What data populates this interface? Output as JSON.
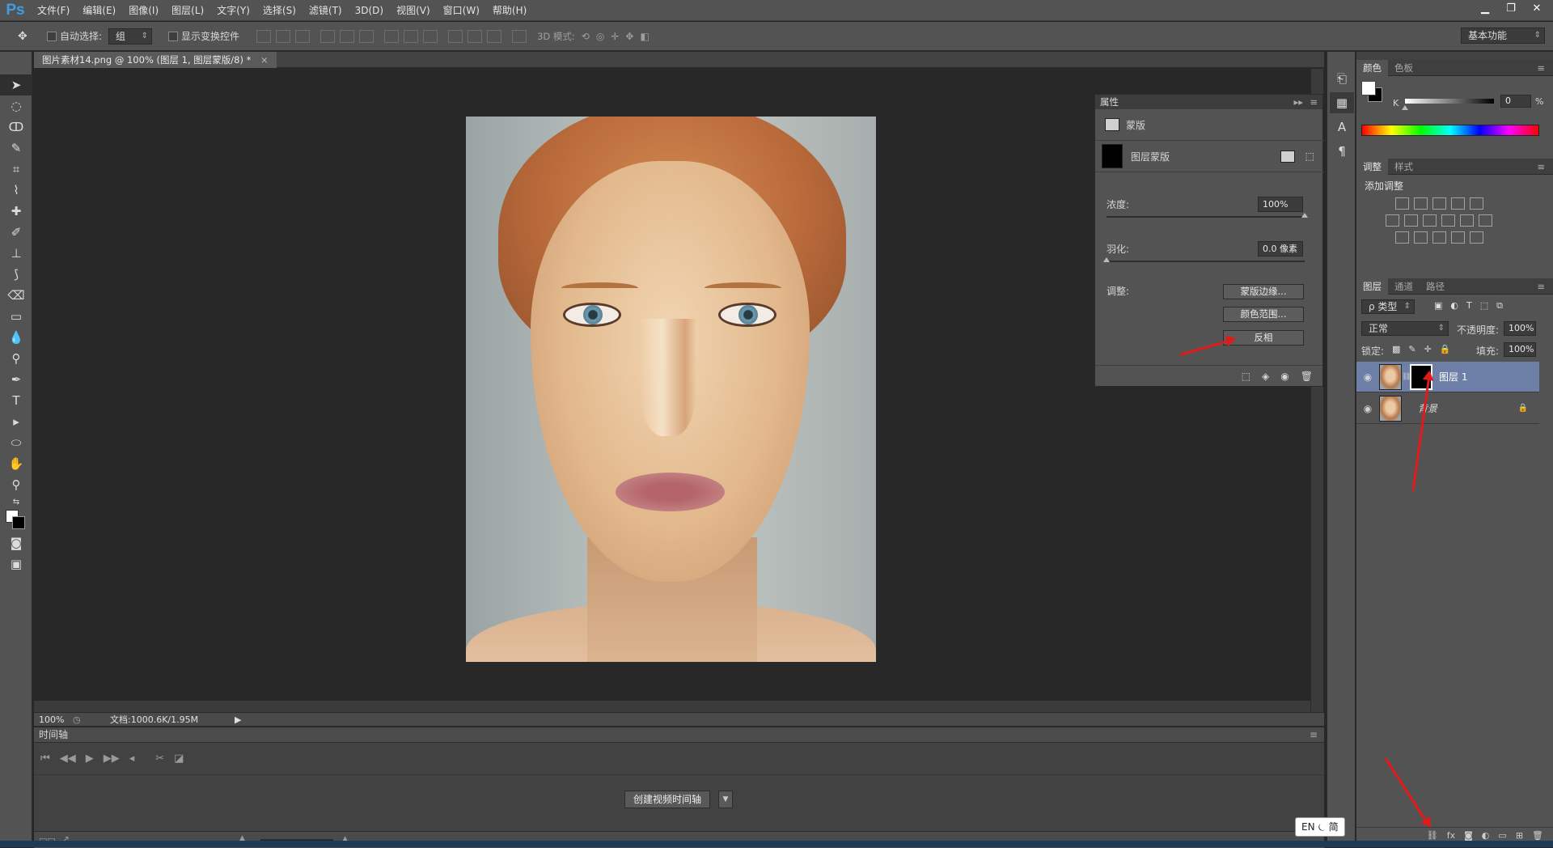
{
  "app": {
    "logo": "Ps",
    "menus": [
      "文件(F)",
      "编辑(E)",
      "图像(I)",
      "图层(L)",
      "文字(Y)",
      "选择(S)",
      "滤镜(T)",
      "3D(D)",
      "视图(V)",
      "窗口(W)",
      "帮助(H)"
    ]
  },
  "window": {
    "minimize": "▁",
    "restore": "❐",
    "close": "✕"
  },
  "options": {
    "auto_select_label": "自动选择:",
    "auto_select_value": "组",
    "show_transform_label": "显示变换控件",
    "mode_3d_label": "3D 模式:",
    "workspace": "基本功能"
  },
  "document": {
    "tab_title": "图片素材14.png @ 100% (图层 1, 图层蒙版/8) *",
    "tab_close": "×",
    "zoom": "100%",
    "doc_info": "文档:1000.6K/1.95M"
  },
  "timeline": {
    "title": "时间轴",
    "create_button": "创建视频时间轴"
  },
  "properties": {
    "title": "属性",
    "section": "蒙版",
    "mask_type": "图层蒙版",
    "density_label": "浓度:",
    "density_value": "100%",
    "density_fraction": 1.0,
    "feather_label": "羽化:",
    "feather_value": "0.0 像素",
    "feather_fraction": 0.0,
    "adjust_label": "调整:",
    "buttons": {
      "mask_edge": "蒙版边缘...",
      "color_range": "颜色范围...",
      "invert": "反相"
    }
  },
  "color_panel": {
    "tabs": [
      "颜色",
      "色板"
    ],
    "k_label": "K",
    "k_value": "0",
    "k_unit": "%"
  },
  "adjustments_panel": {
    "tabs": [
      "调整",
      "样式"
    ],
    "add_label": "添加调整"
  },
  "layers_panel": {
    "tabs": [
      "图层",
      "通道",
      "路径"
    ],
    "filter_label": "ρ 类型",
    "blend_mode": "正常",
    "opacity_label": "不透明度:",
    "opacity_value": "100%",
    "lock_label": "锁定:",
    "fill_label": "填充:",
    "fill_value": "100%",
    "layers": [
      {
        "name": "图层 1",
        "selected": true
      },
      {
        "name": "背景",
        "locked": true
      }
    ]
  },
  "ime": {
    "text": "EN ⏾ 简"
  },
  "colors": {
    "accent": "#3d9de5",
    "arrow": "#e11b1b",
    "selected_layer": "#6d7fa6"
  }
}
